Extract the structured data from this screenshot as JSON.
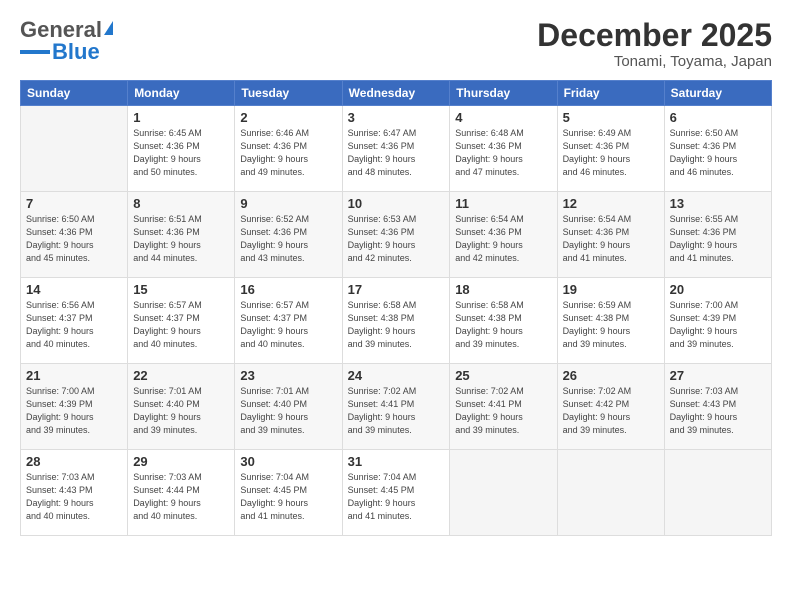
{
  "header": {
    "logo_general": "General",
    "logo_blue": "Blue",
    "title": "December 2025",
    "subtitle": "Tonami, Toyama, Japan"
  },
  "weekdays": [
    "Sunday",
    "Monday",
    "Tuesday",
    "Wednesday",
    "Thursday",
    "Friday",
    "Saturday"
  ],
  "weeks": [
    [
      {
        "day": "",
        "info": ""
      },
      {
        "day": "1",
        "info": "Sunrise: 6:45 AM\nSunset: 4:36 PM\nDaylight: 9 hours\nand 50 minutes."
      },
      {
        "day": "2",
        "info": "Sunrise: 6:46 AM\nSunset: 4:36 PM\nDaylight: 9 hours\nand 49 minutes."
      },
      {
        "day": "3",
        "info": "Sunrise: 6:47 AM\nSunset: 4:36 PM\nDaylight: 9 hours\nand 48 minutes."
      },
      {
        "day": "4",
        "info": "Sunrise: 6:48 AM\nSunset: 4:36 PM\nDaylight: 9 hours\nand 47 minutes."
      },
      {
        "day": "5",
        "info": "Sunrise: 6:49 AM\nSunset: 4:36 PM\nDaylight: 9 hours\nand 46 minutes."
      },
      {
        "day": "6",
        "info": "Sunrise: 6:50 AM\nSunset: 4:36 PM\nDaylight: 9 hours\nand 46 minutes."
      }
    ],
    [
      {
        "day": "7",
        "info": "Sunrise: 6:50 AM\nSunset: 4:36 PM\nDaylight: 9 hours\nand 45 minutes."
      },
      {
        "day": "8",
        "info": "Sunrise: 6:51 AM\nSunset: 4:36 PM\nDaylight: 9 hours\nand 44 minutes."
      },
      {
        "day": "9",
        "info": "Sunrise: 6:52 AM\nSunset: 4:36 PM\nDaylight: 9 hours\nand 43 minutes."
      },
      {
        "day": "10",
        "info": "Sunrise: 6:53 AM\nSunset: 4:36 PM\nDaylight: 9 hours\nand 42 minutes."
      },
      {
        "day": "11",
        "info": "Sunrise: 6:54 AM\nSunset: 4:36 PM\nDaylight: 9 hours\nand 42 minutes."
      },
      {
        "day": "12",
        "info": "Sunrise: 6:54 AM\nSunset: 4:36 PM\nDaylight: 9 hours\nand 41 minutes."
      },
      {
        "day": "13",
        "info": "Sunrise: 6:55 AM\nSunset: 4:36 PM\nDaylight: 9 hours\nand 41 minutes."
      }
    ],
    [
      {
        "day": "14",
        "info": "Sunrise: 6:56 AM\nSunset: 4:37 PM\nDaylight: 9 hours\nand 40 minutes."
      },
      {
        "day": "15",
        "info": "Sunrise: 6:57 AM\nSunset: 4:37 PM\nDaylight: 9 hours\nand 40 minutes."
      },
      {
        "day": "16",
        "info": "Sunrise: 6:57 AM\nSunset: 4:37 PM\nDaylight: 9 hours\nand 40 minutes."
      },
      {
        "day": "17",
        "info": "Sunrise: 6:58 AM\nSunset: 4:38 PM\nDaylight: 9 hours\nand 39 minutes."
      },
      {
        "day": "18",
        "info": "Sunrise: 6:58 AM\nSunset: 4:38 PM\nDaylight: 9 hours\nand 39 minutes."
      },
      {
        "day": "19",
        "info": "Sunrise: 6:59 AM\nSunset: 4:38 PM\nDaylight: 9 hours\nand 39 minutes."
      },
      {
        "day": "20",
        "info": "Sunrise: 7:00 AM\nSunset: 4:39 PM\nDaylight: 9 hours\nand 39 minutes."
      }
    ],
    [
      {
        "day": "21",
        "info": "Sunrise: 7:00 AM\nSunset: 4:39 PM\nDaylight: 9 hours\nand 39 minutes."
      },
      {
        "day": "22",
        "info": "Sunrise: 7:01 AM\nSunset: 4:40 PM\nDaylight: 9 hours\nand 39 minutes."
      },
      {
        "day": "23",
        "info": "Sunrise: 7:01 AM\nSunset: 4:40 PM\nDaylight: 9 hours\nand 39 minutes."
      },
      {
        "day": "24",
        "info": "Sunrise: 7:02 AM\nSunset: 4:41 PM\nDaylight: 9 hours\nand 39 minutes."
      },
      {
        "day": "25",
        "info": "Sunrise: 7:02 AM\nSunset: 4:41 PM\nDaylight: 9 hours\nand 39 minutes."
      },
      {
        "day": "26",
        "info": "Sunrise: 7:02 AM\nSunset: 4:42 PM\nDaylight: 9 hours\nand 39 minutes."
      },
      {
        "day": "27",
        "info": "Sunrise: 7:03 AM\nSunset: 4:43 PM\nDaylight: 9 hours\nand 39 minutes."
      }
    ],
    [
      {
        "day": "28",
        "info": "Sunrise: 7:03 AM\nSunset: 4:43 PM\nDaylight: 9 hours\nand 40 minutes."
      },
      {
        "day": "29",
        "info": "Sunrise: 7:03 AM\nSunset: 4:44 PM\nDaylight: 9 hours\nand 40 minutes."
      },
      {
        "day": "30",
        "info": "Sunrise: 7:04 AM\nSunset: 4:45 PM\nDaylight: 9 hours\nand 41 minutes."
      },
      {
        "day": "31",
        "info": "Sunrise: 7:04 AM\nSunset: 4:45 PM\nDaylight: 9 hours\nand 41 minutes."
      },
      {
        "day": "",
        "info": ""
      },
      {
        "day": "",
        "info": ""
      },
      {
        "day": "",
        "info": ""
      }
    ]
  ]
}
